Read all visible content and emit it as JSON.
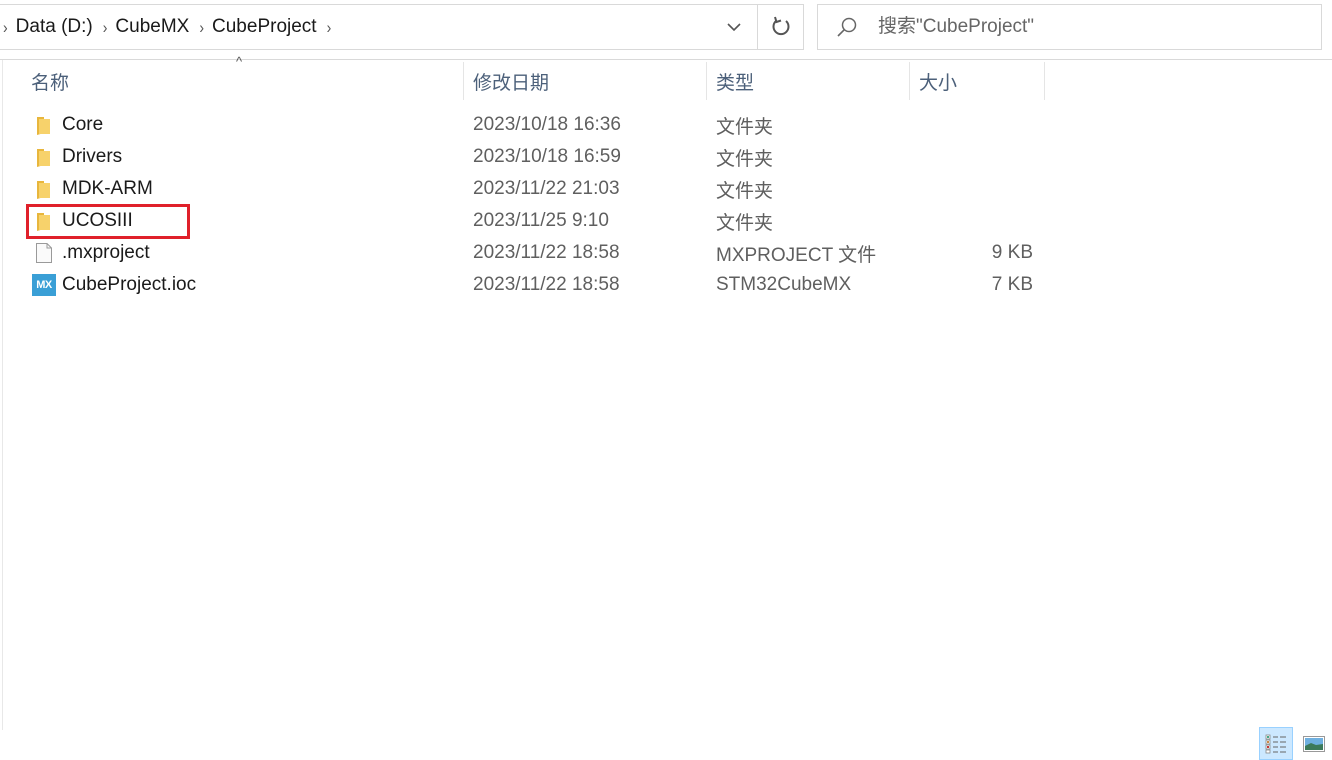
{
  "address_bar": {
    "breadcrumbs": [
      "Data (D:)",
      "CubeMX",
      "CubeProject"
    ],
    "dropdown_icon": "chevron-down-icon",
    "refresh_icon": "refresh-icon"
  },
  "search": {
    "placeholder": "搜索\"CubeProject\"",
    "icon": "search-icon"
  },
  "columns": {
    "name": "名称",
    "date": "修改日期",
    "type": "类型",
    "size": "大小",
    "sorted_column": "name",
    "sort_direction": "ascending"
  },
  "files": [
    {
      "name": "Core",
      "date": "2023/10/18 16:36",
      "type": "文件夹",
      "size": "",
      "icon": "folder-icon",
      "highlighted": false
    },
    {
      "name": "Drivers",
      "date": "2023/10/18 16:59",
      "type": "文件夹",
      "size": "",
      "icon": "folder-icon",
      "highlighted": false
    },
    {
      "name": "MDK-ARM",
      "date": "2023/11/22 21:03",
      "type": "文件夹",
      "size": "",
      "icon": "folder-icon",
      "highlighted": false
    },
    {
      "name": "UCOSIII",
      "date": "2023/11/25 9:10",
      "type": "文件夹",
      "size": "",
      "icon": "folder-icon",
      "highlighted": true
    },
    {
      "name": ".mxproject",
      "date": "2023/11/22 18:58",
      "type": "MXPROJECT 文件",
      "size": "9 KB",
      "icon": "file-icon",
      "highlighted": false
    },
    {
      "name": "CubeProject.ioc",
      "date": "2023/11/22 18:58",
      "type": "STM32CubeMX",
      "size": "7 KB",
      "icon": "mx-icon",
      "mx_label": "MX",
      "highlighted": false
    }
  ],
  "highlight_color": "#e0202a",
  "view_modes": [
    {
      "name": "details-view",
      "active": true
    },
    {
      "name": "large-icons-view",
      "active": false
    }
  ]
}
